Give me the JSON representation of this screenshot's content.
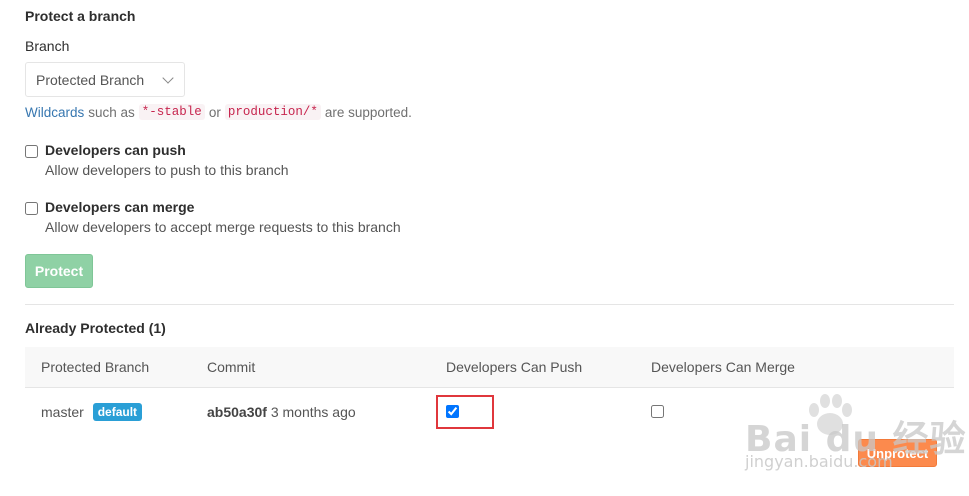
{
  "protect_form": {
    "title": "Protect a branch",
    "branch_label": "Branch",
    "branch_select_value": "Protected Branch",
    "help": {
      "link": "Wildcards",
      "text1": "such as",
      "code1": "*-stable",
      "text2": "or",
      "code2": "production/*",
      "text3": "are supported."
    },
    "push_option": {
      "title": "Developers can push",
      "description": "Allow developers to push to this branch",
      "checked": false
    },
    "merge_option": {
      "title": "Developers can merge",
      "description": "Allow developers to accept merge requests to this branch",
      "checked": false
    },
    "protect_button": "Protect"
  },
  "protected_list": {
    "title": "Already Protected (1)",
    "columns": [
      "Protected Branch",
      "Commit",
      "Developers Can Push",
      "Developers Can Merge"
    ],
    "rows": [
      {
        "branch": "master",
        "badge": "default",
        "commit_sha": "ab50a30f",
        "commit_time": "3 months ago",
        "can_push": true,
        "can_merge": false,
        "action": "Unprotect"
      }
    ]
  },
  "watermark": {
    "logo": "Bai du 经验",
    "url": "jingyan.baidu.com"
  },
  "colors": {
    "link": "#3777b0",
    "protect_button": "#8fd1a5",
    "badge": "#2a9fd6",
    "unprotect_button": "#fc8a4d",
    "highlight_box": "#e0373c"
  }
}
